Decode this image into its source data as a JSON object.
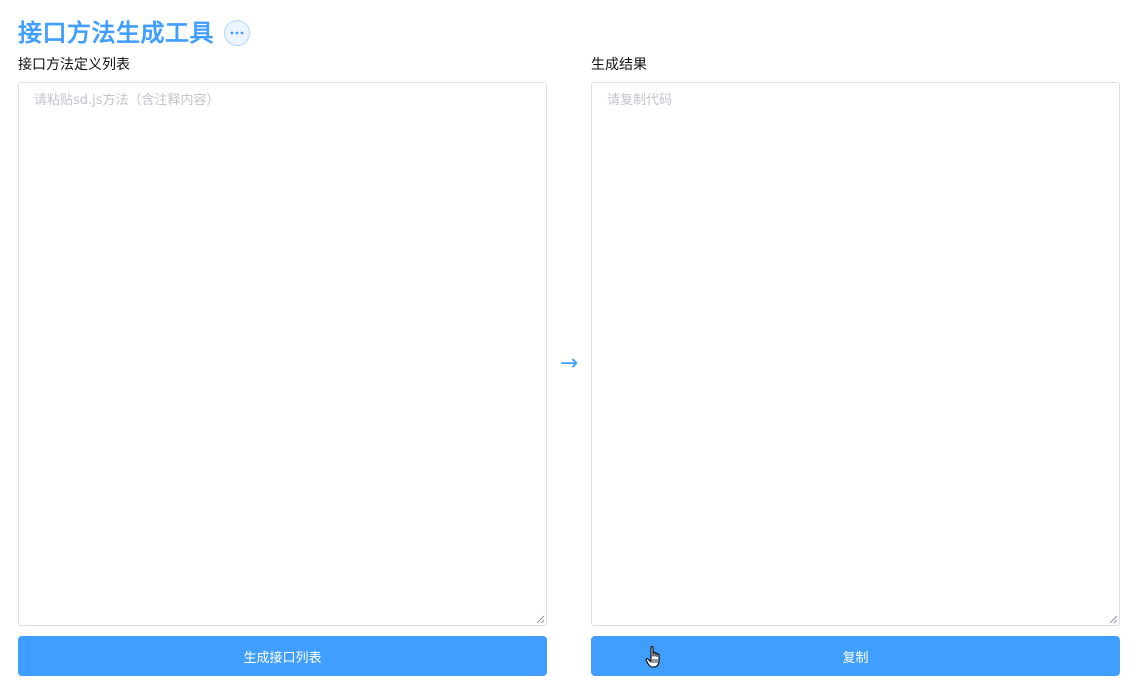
{
  "header": {
    "title": "接口方法生成工具",
    "more_icon": "ellipsis-icon"
  },
  "left_panel": {
    "label": "接口方法定义列表",
    "input_value": "",
    "input_placeholder": "请粘贴sd.js方法（含注释内容）",
    "button_label": "生成接口列表"
  },
  "arrow": {
    "glyph": "→",
    "icon": "arrow-right-icon"
  },
  "right_panel": {
    "label": "生成结果",
    "output_value": "",
    "output_placeholder": "请复制代码",
    "button_label": "复制"
  },
  "colors": {
    "primary": "#409eff",
    "border": "#dcdfe6",
    "placeholder": "#c0c4cc"
  }
}
